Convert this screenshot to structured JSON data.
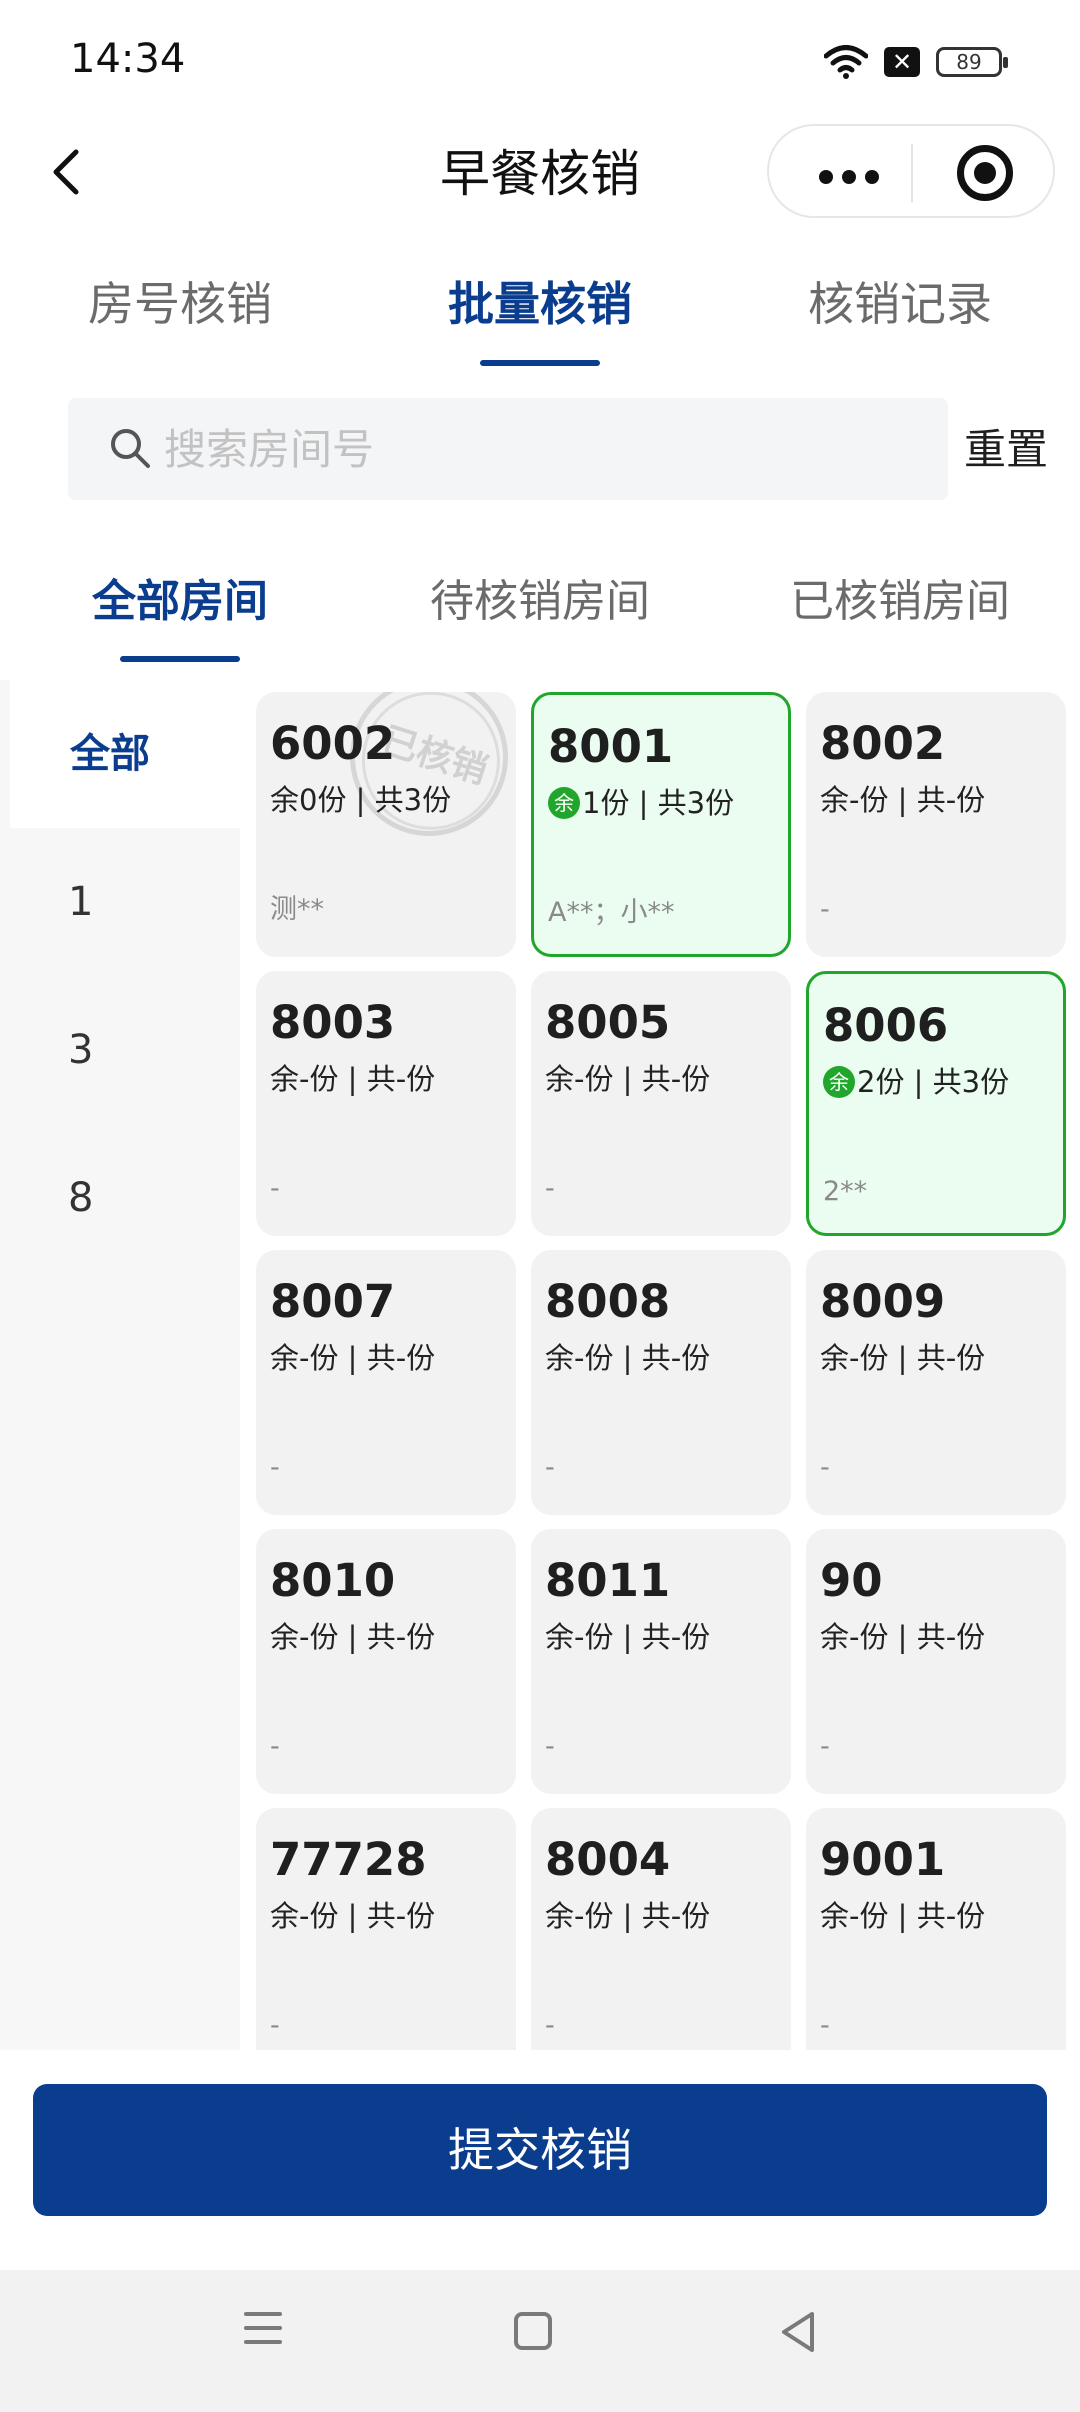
{
  "status_bar": {
    "time": "14:34",
    "icons": [
      "wifi-icon",
      "notification-x-icon",
      "battery-icon"
    ],
    "battery": "89"
  },
  "nav": {
    "title": "早餐核销",
    "back_icon": "chevron-left-icon",
    "capsule_icons": [
      "more-dots-icon",
      "target-icon"
    ]
  },
  "main_tabs": [
    {
      "label": "房号核销",
      "active": false
    },
    {
      "label": "批量核销",
      "active": true
    },
    {
      "label": "核销记录",
      "active": false
    }
  ],
  "search": {
    "placeholder": "搜索房间号",
    "value": "",
    "reset_label": "重置"
  },
  "status_tabs": [
    {
      "label": "全部房间",
      "active": true
    },
    {
      "label": "待核销房间",
      "active": false
    },
    {
      "label": "已核销房间",
      "active": false
    }
  ],
  "floors": [
    {
      "label": "全部",
      "active": true
    },
    {
      "label": "1",
      "active": false
    },
    {
      "label": "3",
      "active": false
    },
    {
      "label": "8",
      "active": false
    }
  ],
  "rooms": [
    {
      "room": "6002",
      "remain": "余0份",
      "total": "共3份",
      "guest": "测**",
      "selected": false,
      "stamp": "已核销"
    },
    {
      "room": "8001",
      "badge": "余",
      "remain": "1份",
      "total": "共3份",
      "guest": "A**；小**",
      "selected": true
    },
    {
      "room": "8002",
      "remain": "余-份",
      "total": "共-份",
      "guest": "-",
      "selected": false
    },
    {
      "room": "8003",
      "remain": "余-份",
      "total": "共-份",
      "guest": "-",
      "selected": false
    },
    {
      "room": "8005",
      "remain": "余-份",
      "total": "共-份",
      "guest": "-",
      "selected": false
    },
    {
      "room": "8006",
      "badge": "余",
      "remain": "2份",
      "total": "共3份",
      "guest": "2**",
      "selected": true
    },
    {
      "room": "8007",
      "remain": "余-份",
      "total": "共-份",
      "guest": "-",
      "selected": false
    },
    {
      "room": "8008",
      "remain": "余-份",
      "total": "共-份",
      "guest": "-",
      "selected": false
    },
    {
      "room": "8009",
      "remain": "余-份",
      "total": "共-份",
      "guest": "-",
      "selected": false
    },
    {
      "room": "8010",
      "remain": "余-份",
      "total": "共-份",
      "guest": "-",
      "selected": false
    },
    {
      "room": "8011",
      "remain": "余-份",
      "total": "共-份",
      "guest": "-",
      "selected": false
    },
    {
      "room": "90",
      "remain": "余-份",
      "total": "共-份",
      "guest": "-",
      "selected": false
    },
    {
      "room": "77728",
      "remain": "余-份",
      "total": "共-份",
      "guest": "-",
      "selected": false
    },
    {
      "room": "8004",
      "remain": "余-份",
      "total": "共-份",
      "guest": "-",
      "selected": false
    },
    {
      "room": "9001",
      "remain": "余-份",
      "total": "共-份",
      "guest": "-",
      "selected": false
    }
  ],
  "submit_label": "提交核销",
  "system_nav": [
    "menu-icon",
    "home-icon",
    "back-triangle-icon"
  ],
  "colors": {
    "accent": "#0b3d8f",
    "selected_border": "#1fa62b",
    "selected_bg": "#eafdf0",
    "card_bg": "#f2f2f3"
  }
}
